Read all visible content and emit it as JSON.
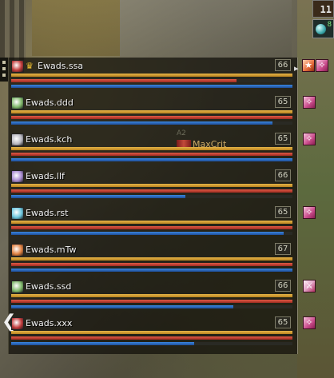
{
  "corner": {
    "count": "11",
    "orb_value": "8"
  },
  "overlay": {
    "small_label": "A2",
    "label": "MaxCrit"
  },
  "party": [
    {
      "name": "Ewads.ssa",
      "level": "66",
      "leader": true,
      "avatar": "red-avatar",
      "cp": 1.0,
      "hp": 0.8,
      "mp": 1.0,
      "buffs": [
        "red-fire-buff-icon",
        "pink-buff-icon"
      ]
    },
    {
      "name": "Ewads.ddd",
      "level": "65",
      "leader": false,
      "avatar": "green-avatar",
      "cp": 1.0,
      "hp": 1.0,
      "mp": 0.93,
      "buffs": [
        "pink-buff-icon"
      ]
    },
    {
      "name": "Ewads.kch",
      "level": "65",
      "leader": false,
      "avatar": "grey-avatar",
      "cp": 1.0,
      "hp": 1.0,
      "mp": 1.0,
      "buffs": [
        "pink-buff-icon"
      ]
    },
    {
      "name": "Ewads.llf",
      "level": "66",
      "leader": false,
      "avatar": "purple-avatar",
      "cp": 1.0,
      "hp": 1.0,
      "mp": 0.62,
      "buffs": []
    },
    {
      "name": "Ewads.rst",
      "level": "65",
      "leader": false,
      "avatar": "cyan-avatar",
      "cp": 1.0,
      "hp": 1.0,
      "mp": 0.97,
      "buffs": [
        "pink-buff-icon"
      ]
    },
    {
      "name": "Ewads.mTw",
      "level": "67",
      "leader": false,
      "avatar": "orange-avatar",
      "cp": 1.0,
      "hp": 1.0,
      "mp": 1.0,
      "buffs": []
    },
    {
      "name": "Ewads.ssd",
      "level": "66",
      "leader": false,
      "avatar": "green-avatar",
      "cp": 1.0,
      "hp": 1.0,
      "mp": 0.79,
      "buffs": [
        "sword-buff-icon"
      ]
    },
    {
      "name": "Ewads.xxx",
      "level": "65",
      "leader": false,
      "avatar": "red-avatar",
      "cp": 1.0,
      "hp": 1.0,
      "mp": 0.65,
      "buffs": [
        "pink-buff-icon"
      ]
    }
  ],
  "colors": {
    "cp": "#e6b448",
    "hp": "#e05a46",
    "mp": "#3a86de",
    "avatar": {
      "red-avatar": "#c03a3a",
      "green-avatar": "#7fb86a",
      "grey-avatar": "#b8b8c0",
      "purple-avatar": "#a78ad0",
      "cyan-avatar": "#6cc6de",
      "orange-avatar": "#e08040"
    }
  }
}
